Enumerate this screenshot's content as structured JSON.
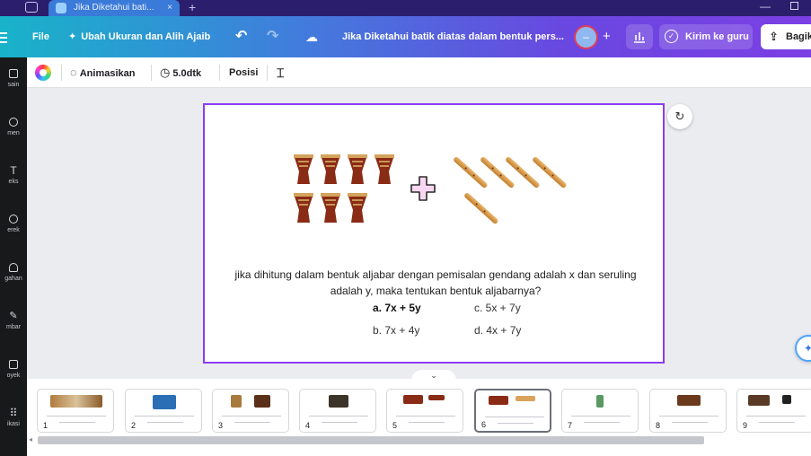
{
  "browser": {
    "tab_title": "Jika Diketahui bati...",
    "tab_close": "×",
    "new_tab": "+",
    "minimize": "—"
  },
  "header": {
    "file_label": "File",
    "resize_label": "Ubah Ukuran dan Alih Ajaib",
    "resize_icon": "sparkle-icon",
    "doc_title": "Jika Diketahui batik diatas dalam bentuk pers...",
    "add_label": "+",
    "send_label": "Kirim ke guru",
    "share_label": "Bagik",
    "brand_colors": [
      "#18b3c9",
      "#3f7fdc",
      "#6a47e0",
      "#7b3fe4"
    ]
  },
  "rail": {
    "items": [
      {
        "label": "sain",
        "icon": "design-icon"
      },
      {
        "label": "men",
        "icon": "elements-icon"
      },
      {
        "label": "eks",
        "icon": "text-icon"
      },
      {
        "label": "erek",
        "icon": "brand-icon"
      },
      {
        "label": "gahan",
        "icon": "upload-icon"
      },
      {
        "label": "mbar",
        "icon": "draw-icon"
      },
      {
        "label": "oyek",
        "icon": "projects-icon"
      },
      {
        "label": "ikasi",
        "icon": "apps-icon"
      }
    ]
  },
  "toolbar": {
    "animate_label": "Animasikan",
    "duration_label": "5.0dtk",
    "position_label": "Posisi"
  },
  "slide": {
    "plus_sign": "+",
    "question": "jika dihitung dalam bentuk aljabar dengan pemisalan gendang adalah x dan seruling adalah y, maka tentukan bentuk aljabarnya?",
    "options": {
      "a": "a. 7x + 5y",
      "b": "b. 7x + 4y",
      "c": "c. 5x + 7y",
      "d": "d. 4x + 7y"
    },
    "drum_count": 7,
    "flute_count": 5
  },
  "filmstrip": {
    "pages": [
      "1",
      "2",
      "3",
      "4",
      "5",
      "6",
      "7",
      "8",
      "9"
    ],
    "active_page": "6"
  },
  "workspace": {
    "collapse_icon": "⌄"
  }
}
